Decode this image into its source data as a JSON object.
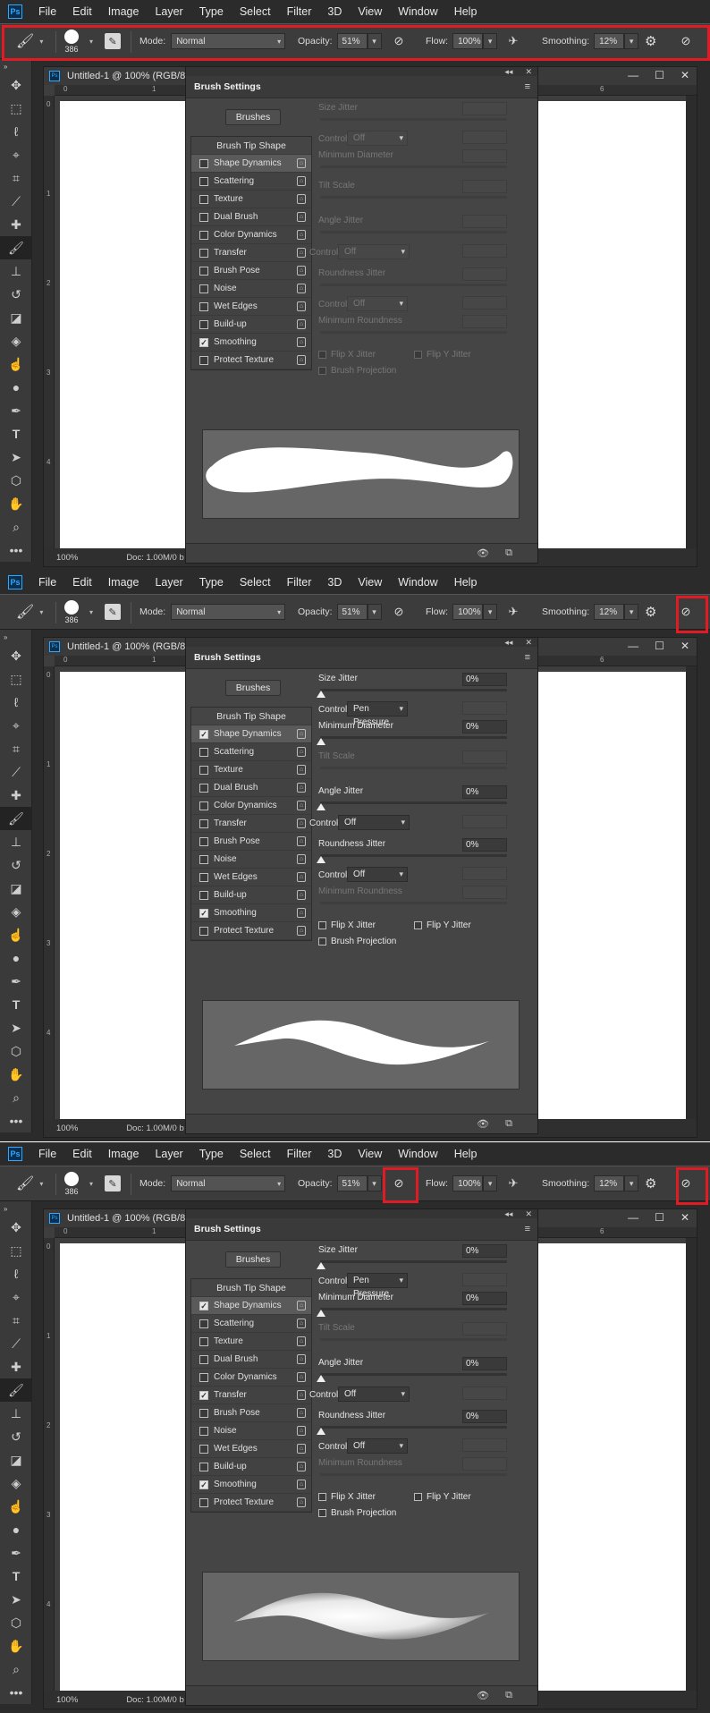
{
  "app": {
    "logo": "Ps",
    "menu": [
      "File",
      "Edit",
      "Image",
      "Layer",
      "Type",
      "Select",
      "Filter",
      "3D",
      "View",
      "Window",
      "Help"
    ]
  },
  "options_bar": {
    "brush_size": "386",
    "mode_label": "Mode:",
    "mode_value": "Normal",
    "opacity_label": "Opacity:",
    "opacity_value": "51%",
    "flow_label": "Flow:",
    "flow_value": "100%",
    "smoothing_label": "Smoothing:",
    "smoothing_value": "12%"
  },
  "document": {
    "title": "Untitled-1 @ 100% (RGB/8",
    "zoom": "100%",
    "doc_info": "Doc: 1.00M/0 b",
    "ruler_h": [
      "0",
      "1",
      "6"
    ],
    "ruler_v": [
      "0",
      "1",
      "2",
      "3",
      "4"
    ]
  },
  "brush_panel": {
    "title": "Brush Settings",
    "brushes_button": "Brushes",
    "tip_shape": "Brush Tip Shape",
    "labels": {
      "size_jitter": "Size Jitter",
      "control": "Control:",
      "min_diameter": "Minimum Diameter",
      "tilt_scale": "Tilt Scale",
      "angle_jitter": "Angle Jitter",
      "roundness_jitter": "Roundness Jitter",
      "min_roundness": "Minimum Roundness",
      "flip_x": "Flip X Jitter",
      "flip_y": "Flip Y Jitter",
      "projection": "Brush Projection"
    },
    "values": {
      "zero": "0%",
      "off": "Off",
      "pen_pressure": "Pen Pressure"
    }
  },
  "frames": [
    {
      "options": [
        "Shape Dynamics",
        "Scattering",
        "Texture",
        "Dual Brush",
        "Color Dynamics",
        "Transfer",
        "Brush Pose",
        "Noise",
        "Wet Edges",
        "Build-up",
        "Smoothing",
        "Protect Texture"
      ],
      "checked": [
        false,
        false,
        false,
        false,
        false,
        false,
        false,
        false,
        false,
        false,
        true,
        false
      ]
    },
    {
      "options": [
        "Shape Dynamics",
        "Scattering",
        "Texture",
        "Dual Brush",
        "Color Dynamics",
        "Transfer",
        "Brush Pose",
        "Noise",
        "Wet Edges",
        "Build-up",
        "Smoothing",
        "Protect Texture"
      ],
      "checked": [
        true,
        false,
        false,
        false,
        false,
        false,
        false,
        false,
        false,
        false,
        true,
        false
      ]
    },
    {
      "options": [
        "Shape Dynamics",
        "Scattering",
        "Texture",
        "Dual Brush",
        "Color Dynamics",
        "Transfer",
        "Brush Pose",
        "Noise",
        "Wet Edges",
        "Build-up",
        "Smoothing",
        "Protect Texture"
      ],
      "checked": [
        true,
        false,
        false,
        false,
        false,
        true,
        false,
        false,
        false,
        false,
        true,
        false
      ]
    }
  ],
  "colors": {
    "highlight": "#e11b24",
    "ps_blue": "#31a8ff"
  }
}
